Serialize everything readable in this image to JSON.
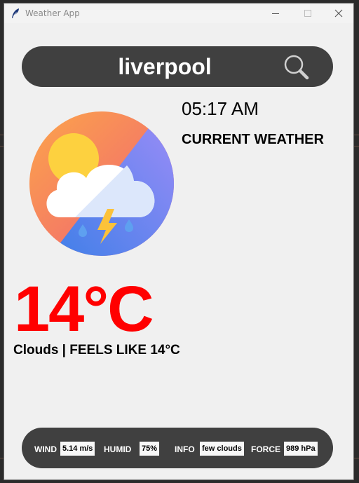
{
  "window": {
    "title": "Weather App",
    "icon": "feather-icon",
    "controls": [
      "minimize-icon",
      "maximize-icon",
      "close-icon"
    ]
  },
  "search": {
    "value": "liverpool",
    "icon": "search-icon"
  },
  "weather": {
    "time": "05:17 AM",
    "heading": "CURRENT WEATHER",
    "icon": "thunderstorm-cloud-icon",
    "temperature": "14°C",
    "condition_line": "Clouds | FEELS LIKE 14°C"
  },
  "details": {
    "wind_label": "WIND",
    "wind_value": "5.14 m/s",
    "humid_label": "HUMID",
    "humid_value": "75%",
    "info_label": "INFO",
    "info_value": "few clouds",
    "force_label": "FORCE",
    "force_value": "989 hPa"
  },
  "colors": {
    "window_bg": "#f0f0f0",
    "bar_bg": "#404040",
    "temperature": "#ff0000",
    "value_box": "#f7f7f7"
  }
}
